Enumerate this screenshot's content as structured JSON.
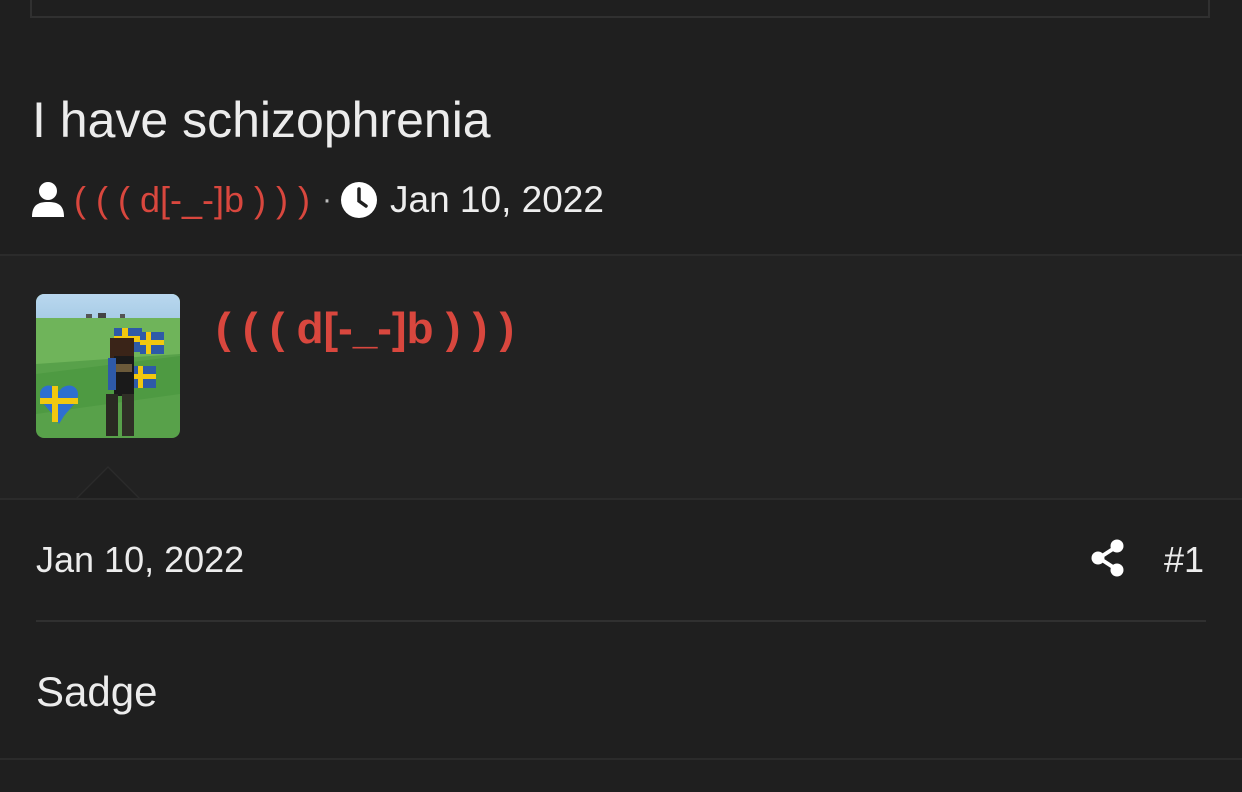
{
  "thread": {
    "title": "I have schizophrenia",
    "author": "( ( ( d[-_-]b ) ) )",
    "separator": "·",
    "date": "Jan 10, 2022"
  },
  "post": {
    "username": "( ( ( d[-_-]b ) ) )",
    "date": "Jan 10, 2022",
    "number": "#1",
    "body": "Sadge"
  },
  "icons": {
    "author": "user-icon",
    "date": "clock-icon",
    "share": "share-icon"
  },
  "colors": {
    "background": "#1f1f1f",
    "username": "#d9473e",
    "text": "#ececec"
  }
}
